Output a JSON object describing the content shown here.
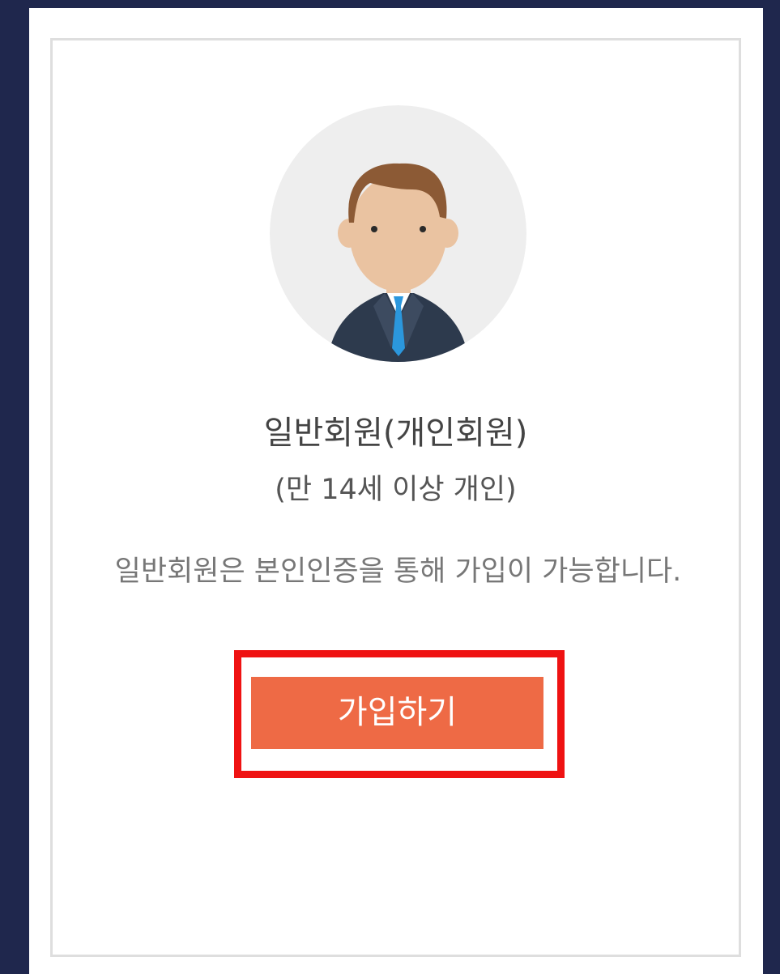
{
  "member_card": {
    "avatar_icon": "businessman-avatar-icon",
    "title": "일반회원(개인회원)",
    "subtitle": "(만 14세 이상 개인)",
    "description": "일반회원은 본인인증을 통해 가입이 가능합니다.",
    "join_button_label": "가입하기"
  },
  "colors": {
    "page_background": "#1f274d",
    "button": "#ee6a45",
    "highlight_box": "#ef1212"
  }
}
